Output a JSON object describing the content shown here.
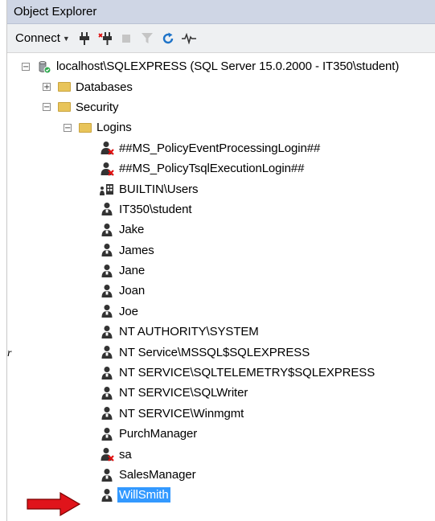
{
  "panel": {
    "title": "Object Explorer"
  },
  "toolbar": {
    "connect_label": "Connect",
    "icons": [
      "connect-plug-icon",
      "disconnect-icon",
      "stop-icon",
      "filter-icon",
      "refresh-icon",
      "activity-monitor-icon"
    ]
  },
  "tree": {
    "server": {
      "label": "localhost\\SQLEXPRESS (SQL Server 15.0.2000 - IT350\\student)",
      "expanded": true
    },
    "databases": {
      "label": "Databases",
      "expanded": false
    },
    "security": {
      "label": "Security",
      "expanded": true
    },
    "logins": {
      "label": "Logins",
      "expanded": true,
      "items": [
        {
          "label": "##MS_PolicyEventProcessingLogin##",
          "icon": "login-disabled-icon"
        },
        {
          "label": "##MS_PolicyTsqlExecutionLogin##",
          "icon": "login-disabled-icon"
        },
        {
          "label": "BUILTIN\\Users",
          "icon": "windows-group-login-icon"
        },
        {
          "label": "IT350\\student",
          "icon": "login-icon"
        },
        {
          "label": "Jake",
          "icon": "login-icon"
        },
        {
          "label": "James",
          "icon": "login-icon"
        },
        {
          "label": "Jane",
          "icon": "login-icon"
        },
        {
          "label": "Joan",
          "icon": "login-icon"
        },
        {
          "label": "Joe",
          "icon": "login-icon"
        },
        {
          "label": "NT AUTHORITY\\SYSTEM",
          "icon": "login-icon"
        },
        {
          "label": "NT Service\\MSSQL$SQLEXPRESS",
          "icon": "login-icon"
        },
        {
          "label": "NT SERVICE\\SQLTELEMETRY$SQLEXPRESS",
          "icon": "login-icon"
        },
        {
          "label": "NT SERVICE\\SQLWriter",
          "icon": "login-icon"
        },
        {
          "label": "NT SERVICE\\Winmgmt",
          "icon": "login-icon"
        },
        {
          "label": "PurchManager",
          "icon": "login-icon"
        },
        {
          "label": "sa",
          "icon": "login-disabled-icon"
        },
        {
          "label": "SalesManager",
          "icon": "login-icon"
        },
        {
          "label": "WillSmith",
          "icon": "login-icon",
          "selected": true
        }
      ]
    }
  },
  "annotation": {
    "side_mark": "r",
    "arrow_color": "#e0141b"
  }
}
